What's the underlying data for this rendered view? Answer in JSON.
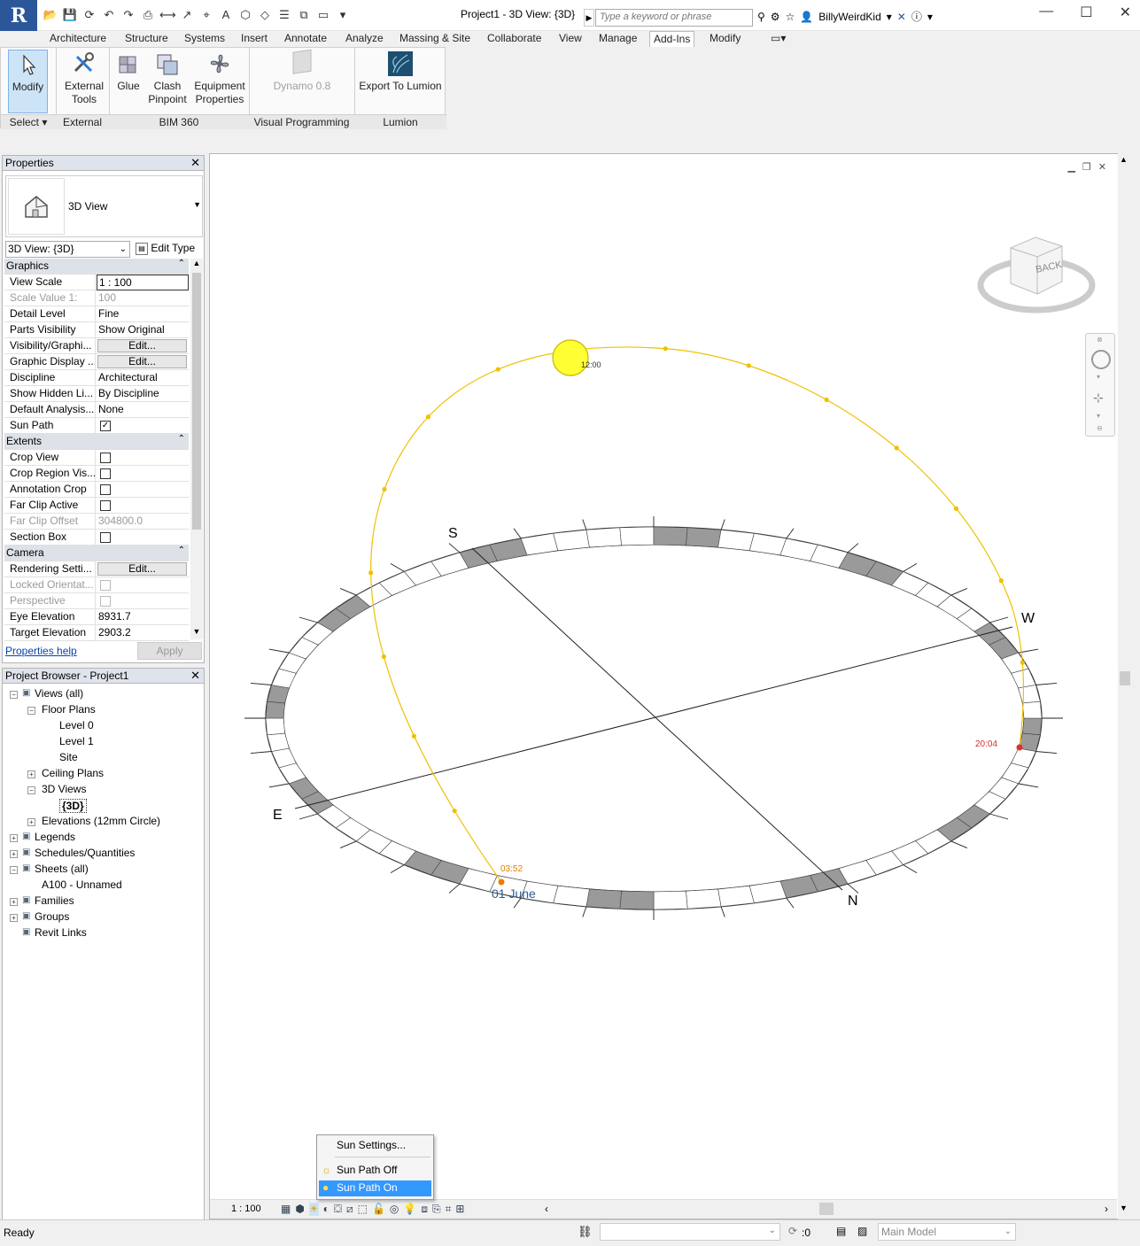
{
  "app": {
    "logo": "R",
    "title": "Project1 - 3D View: {3D}"
  },
  "search": {
    "placeholder": "Type a keyword or phrase"
  },
  "user": {
    "name": "BillyWeirdKid"
  },
  "ribbon_tabs": [
    "Architecture",
    "Structure",
    "Systems",
    "Insert",
    "Annotate",
    "Analyze",
    "Massing & Site",
    "Collaborate",
    "View",
    "Manage",
    "Add-Ins",
    "Modify"
  ],
  "active_tab": "Add-Ins",
  "ribbon": {
    "modify": "Modify",
    "external_tools_1": "External",
    "external_tools_2": "Tools",
    "glue": "Glue",
    "clash_1": "Clash",
    "clash_2": "Pinpoint",
    "equip_1": "Equipment",
    "equip_2": "Properties",
    "dynamo": "Dynamo 0.8",
    "export_lumion": "Export To Lumion",
    "panels": {
      "select": "Select",
      "external": "External",
      "bim360": "BIM 360",
      "visual": "Visual Programming",
      "lumion": "Lumion"
    }
  },
  "properties": {
    "title": "Properties",
    "type_name": "3D View",
    "instance_selector": "3D View: {3D}",
    "edit_type": "Edit Type",
    "rows": [
      {
        "kind": "group",
        "label": "Graphics"
      },
      {
        "kind": "input",
        "label": "View Scale",
        "value": "1 : 100"
      },
      {
        "kind": "grey",
        "label": "Scale Value    1:",
        "value": "100"
      },
      {
        "kind": "text",
        "label": "Detail Level",
        "value": "Fine"
      },
      {
        "kind": "text",
        "label": "Parts Visibility",
        "value": "Show Original"
      },
      {
        "kind": "button",
        "label": "Visibility/Graphi...",
        "value": "Edit..."
      },
      {
        "kind": "button",
        "label": "Graphic Display ...",
        "value": "Edit..."
      },
      {
        "kind": "text",
        "label": "Discipline",
        "value": "Architectural"
      },
      {
        "kind": "text",
        "label": "Show Hidden Li...",
        "value": "By Discipline"
      },
      {
        "kind": "text",
        "label": "Default Analysis...",
        "value": "None"
      },
      {
        "kind": "check",
        "label": "Sun Path",
        "value": "✓"
      },
      {
        "kind": "group",
        "label": "Extents"
      },
      {
        "kind": "check",
        "label": "Crop View",
        "value": ""
      },
      {
        "kind": "check",
        "label": "Crop Region Vis...",
        "value": ""
      },
      {
        "kind": "check",
        "label": "Annotation Crop",
        "value": ""
      },
      {
        "kind": "check",
        "label": "Far Clip Active",
        "value": ""
      },
      {
        "kind": "grey",
        "label": "Far Clip Offset",
        "value": "304800.0"
      },
      {
        "kind": "check",
        "label": "Section Box",
        "value": ""
      },
      {
        "kind": "group",
        "label": "Camera"
      },
      {
        "kind": "button",
        "label": "Rendering Setti...",
        "value": "Edit..."
      },
      {
        "kind": "greycheck",
        "label": "Locked Orientat...",
        "value": ""
      },
      {
        "kind": "greycheck",
        "label": "Perspective",
        "value": ""
      },
      {
        "kind": "text",
        "label": "Eye Elevation",
        "value": "8931.7"
      },
      {
        "kind": "text",
        "label": "Target Elevation",
        "value": "2903.2"
      }
    ],
    "help": "Properties help",
    "apply": "Apply"
  },
  "browser": {
    "title": "Project Browser - Project1",
    "items": [
      {
        "label": "Views (all)",
        "indent": 0,
        "exp": "−"
      },
      {
        "label": "Floor Plans",
        "indent": 1,
        "exp": "−"
      },
      {
        "label": "Level 0",
        "indent": 2,
        "exp": ""
      },
      {
        "label": "Level 1",
        "indent": 2,
        "exp": ""
      },
      {
        "label": "Site",
        "indent": 2,
        "exp": ""
      },
      {
        "label": "Ceiling Plans",
        "indent": 1,
        "exp": "+"
      },
      {
        "label": "3D Views",
        "indent": 1,
        "exp": "−"
      },
      {
        "label": "{3D}",
        "indent": 2,
        "exp": "",
        "bold": true
      },
      {
        "label": "Elevations (12mm Circle)",
        "indent": 1,
        "exp": "+"
      },
      {
        "label": "Legends",
        "indent": 0,
        "exp": "+"
      },
      {
        "label": "Schedules/Quantities",
        "indent": 0,
        "exp": "+"
      },
      {
        "label": "Sheets (all)",
        "indent": 0,
        "exp": "−"
      },
      {
        "label": "A100 - Unnamed",
        "indent": 1,
        "exp": ""
      },
      {
        "label": "Families",
        "indent": 0,
        "exp": "+"
      },
      {
        "label": "Groups",
        "indent": 0,
        "exp": "+"
      },
      {
        "label": "Revit Links",
        "indent": 0,
        "exp": ""
      }
    ]
  },
  "view": {
    "cardinal": {
      "s": "S",
      "w": "W",
      "e": "E",
      "n": "N"
    },
    "sun_noon": "12:00",
    "sunrise": "03:52",
    "sunset": "20:04",
    "date": "01 June",
    "viewcube_face": "BACK",
    "scale": "1 : 100"
  },
  "sun_menu": {
    "settings": "Sun Settings...",
    "off": "Sun Path Off",
    "on": "Sun Path On"
  },
  "status": {
    "ready": "Ready",
    "filter_count": ":0",
    "model": "Main Model"
  },
  "colors": {
    "sun_path": "#f0c000",
    "sun_disc": "#ffff33",
    "highlight": "#3399ff",
    "accent": "#2b579a"
  }
}
